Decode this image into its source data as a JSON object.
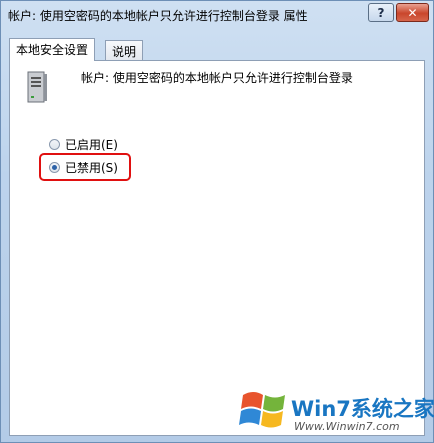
{
  "window": {
    "title": "帐户: 使用空密码的本地帐户只允许进行控制台登录 属性",
    "help_label": "?",
    "close_label": "✕"
  },
  "tabs": [
    {
      "label": "本地安全设置",
      "active": true
    },
    {
      "label": "说明",
      "active": false
    }
  ],
  "policy": {
    "icon": "server-icon",
    "description": "帐户: 使用空密码的本地帐户只允许进行控制台登录"
  },
  "options": [
    {
      "label": "已启用(E)",
      "checked": false
    },
    {
      "label": "已禁用(S)",
      "checked": true
    }
  ],
  "watermark": {
    "brand": "Win7系统之家",
    "url": "Www.Winwin7.com"
  },
  "colors": {
    "highlight": "#e01010",
    "close_button": "#c9462c",
    "watermark_blue": "#1976c2"
  }
}
